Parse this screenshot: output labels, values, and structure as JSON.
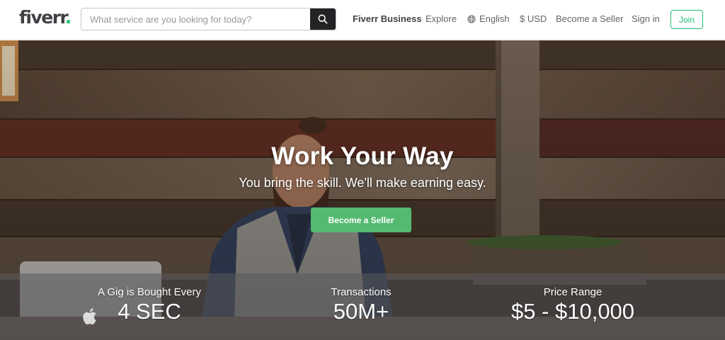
{
  "brand": {
    "name": "fiverr",
    "dot": ".",
    "accent": "#1dbf73"
  },
  "search": {
    "placeholder": "What service are you looking for today?",
    "value": ""
  },
  "nav": {
    "business": "Fiverr Business",
    "explore": "Explore",
    "language": "English",
    "currency": "$ USD",
    "become_seller": "Become a Seller",
    "sign_in": "Sign in",
    "join": "Join"
  },
  "hero": {
    "title": "Work Your Way",
    "subtitle": "You bring the skill. We'll make earning easy.",
    "cta": "Become a Seller",
    "cta_color": "#55ba71"
  },
  "stats": [
    {
      "label": "A Gig is Bought Every",
      "value": "4 SEC"
    },
    {
      "label": "Transactions",
      "value": "50M+"
    },
    {
      "label": "Price Range",
      "value": "$5 - $10,000"
    }
  ],
  "icons": {
    "search": "search-icon",
    "language": "globe-icon",
    "laptop_logo": "apple-logo-icon"
  }
}
